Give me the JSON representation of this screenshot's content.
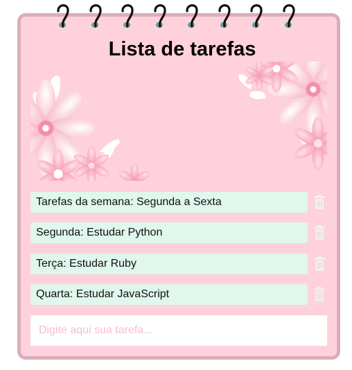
{
  "header": {
    "title": "Lista de tarefas"
  },
  "spiral": {
    "ring_count": 8,
    "ring_color": "#111111",
    "hole_color": "#5a9ea0"
  },
  "banner": {
    "image": "pink-paper-flowers-illustration",
    "background_color": "#ffd1dc"
  },
  "tasks": [
    {
      "text": "Tarefas da semana: Segunda a Sexta",
      "delete_icon": "trash-icon"
    },
    {
      "text": "Segunda: Estudar Python",
      "delete_icon": "trash-icon"
    },
    {
      "text": "Terça: Estudar Ruby",
      "delete_icon": "trash-icon"
    },
    {
      "text": "Quarta: Estudar JavaScript",
      "delete_icon": "trash-icon"
    }
  ],
  "new_task": {
    "placeholder": "Digite aqui sua tarefa...",
    "value": ""
  },
  "colors": {
    "card_background": "#ffd1dc",
    "card_border": "#d8aeb8",
    "task_background": "#dff7ec",
    "trash_icon": "#f0f0f0",
    "placeholder": "#f4bfcd"
  }
}
